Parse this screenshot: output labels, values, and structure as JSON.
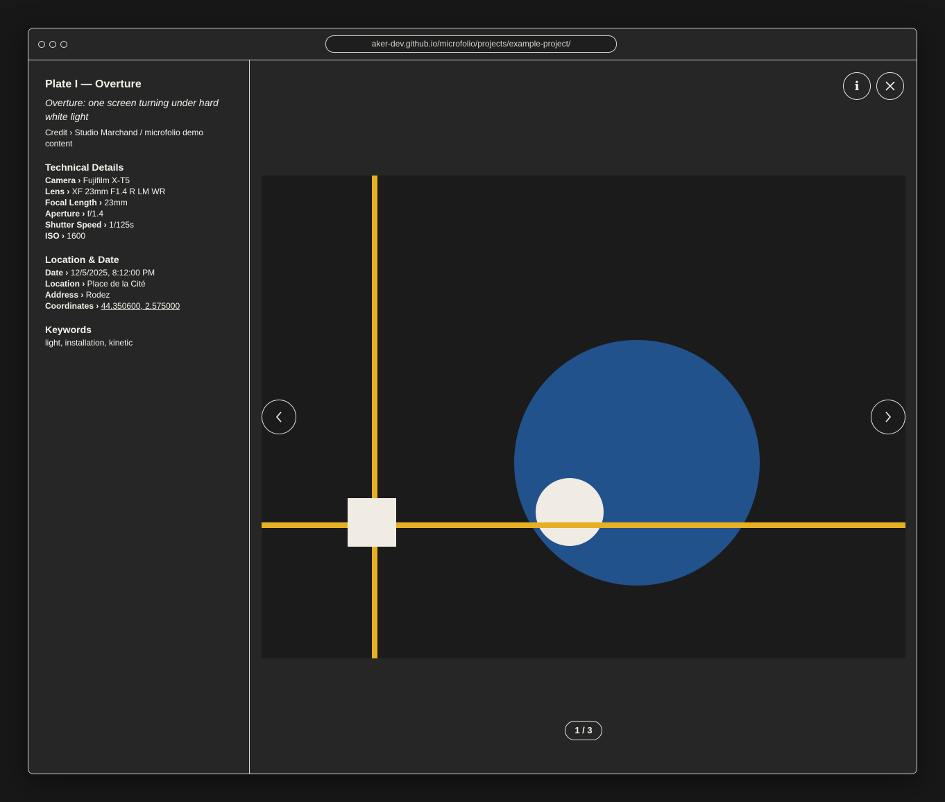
{
  "browser": {
    "url": "aker-dev.github.io/microfolio/projects/example-project/"
  },
  "sidebar": {
    "title": "Plate I — Overture",
    "subtitle": "Overture: one screen turning under hard white light",
    "credit": "Credit › Studio Marchand / microfolio demo content",
    "technical": {
      "heading": "Technical Details",
      "rows": [
        {
          "label": "Camera ›",
          "value": "Fujifilm X-T5"
        },
        {
          "label": "Lens ›",
          "value": "XF 23mm F1.4 R LM WR"
        },
        {
          "label": "Focal Length ›",
          "value": "23mm"
        },
        {
          "label": "Aperture ›",
          "value": "f/1.4"
        },
        {
          "label": "Shutter Speed ›",
          "value": "1/125s"
        },
        {
          "label": "ISO ›",
          "value": "1600"
        }
      ]
    },
    "location": {
      "heading": "Location & Date",
      "rows": [
        {
          "label": "Date ›",
          "value": "12/5/2025, 8:12:00 PM"
        },
        {
          "label": "Location ›",
          "value": "Place de la Cité"
        },
        {
          "label": "Address ›",
          "value": "Rodez"
        },
        {
          "label": "Coordinates ›",
          "value": "44.350600, 2.575000"
        }
      ]
    },
    "keywords": {
      "heading": "Keywords",
      "value": "light, installation, kinetic"
    }
  },
  "viewer": {
    "info_label": "i",
    "counter": "1 / 3",
    "icons": {
      "close": "close-icon",
      "prev": "chevron-left-icon",
      "next": "chevron-right-icon"
    },
    "colors": {
      "background": "#1b1b1b",
      "line": "#e6b022",
      "big_circle": "#21528c",
      "shape": "#f0ece4"
    }
  }
}
